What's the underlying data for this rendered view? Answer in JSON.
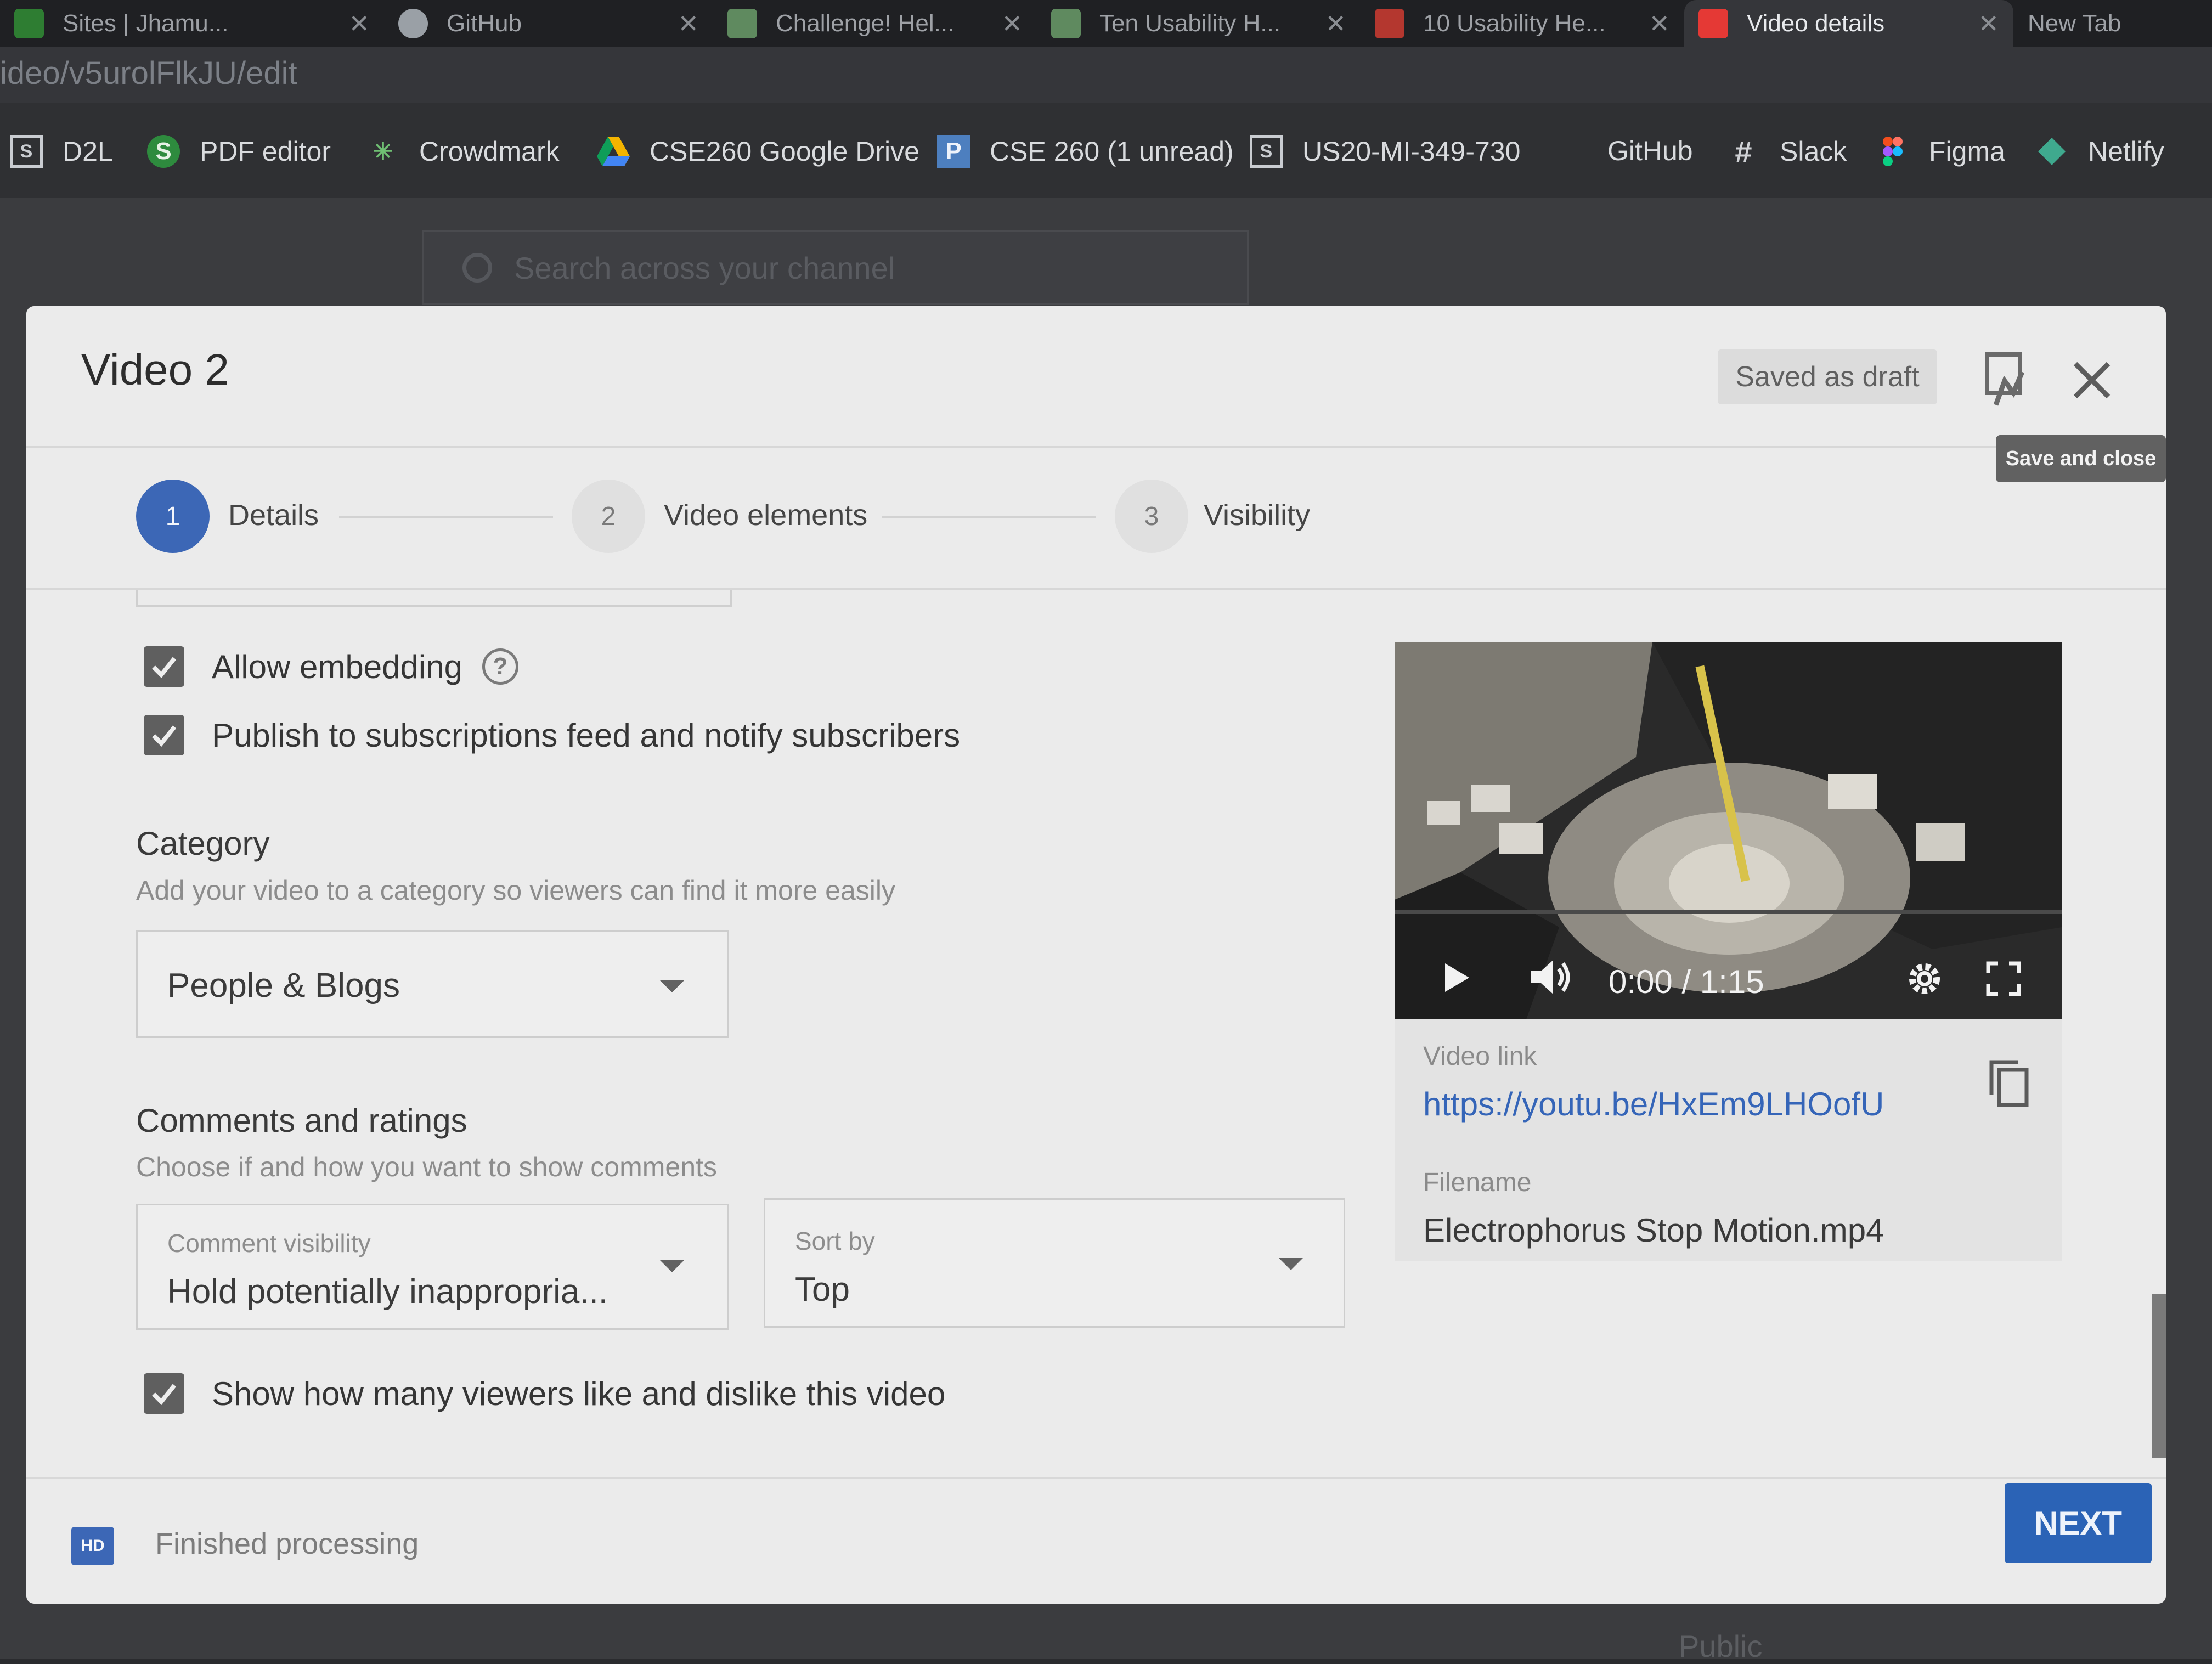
{
  "browser": {
    "tabs": [
      {
        "title": "Sites | Jhamu...",
        "fav_color": "#2e7d32"
      },
      {
        "title": "GitHub",
        "fav_color": "#9aa0a6"
      },
      {
        "title": "Challenge! Hel...",
        "fav_color": "#5f8a5f"
      },
      {
        "title": "Ten Usability H...",
        "fav_color": "#5f8a5f"
      },
      {
        "title": "10 Usability He...",
        "fav_color": "#b4372f"
      },
      {
        "title": "Video details",
        "fav_color": "#e53935"
      },
      {
        "title": "New Tab",
        "fav_color": "#9aa0a6"
      }
    ],
    "url": "ideo/v5urolFlkJU/edit",
    "bookmarks": [
      {
        "label": "D2L",
        "icon": "d2l-icon"
      },
      {
        "label": "PDF editor",
        "icon": "pdf-editor-icon"
      },
      {
        "label": "Crowdmark",
        "icon": "crowdmark-icon"
      },
      {
        "label": "CSE260 Google Drive",
        "icon": "google-drive-icon"
      },
      {
        "label": "CSE 260 (1 unread)",
        "icon": "piazza-icon"
      },
      {
        "label": "US20-MI-349-730",
        "icon": "d2l-icon"
      },
      {
        "label": "GitHub",
        "icon": "github-icon"
      },
      {
        "label": "Slack",
        "icon": "slack-icon"
      },
      {
        "label": "Figma",
        "icon": "figma-icon"
      },
      {
        "label": "Netlify",
        "icon": "netlify-icon"
      }
    ]
  },
  "background_page": {
    "search_placeholder": "Search across your channel",
    "visibility_text": "Public"
  },
  "modal": {
    "title": "Video 2",
    "draft_status": "Saved as draft",
    "close_tooltip": "Save and close",
    "steps": [
      {
        "number": "1",
        "label": "Details",
        "active": true
      },
      {
        "number": "2",
        "label": "Video elements",
        "active": false
      },
      {
        "number": "3",
        "label": "Visibility",
        "active": false
      }
    ],
    "allow_embedding": {
      "label": "Allow embedding",
      "checked": true
    },
    "publish_feed": {
      "label": "Publish to subscriptions feed and notify subscribers",
      "checked": true
    },
    "category": {
      "title": "Category",
      "subtitle": "Add your video to a category so viewers can find it more easily",
      "value": "People & Blogs"
    },
    "comments": {
      "title": "Comments and ratings",
      "subtitle": "Choose if and how you want to show comments",
      "visibility_label": "Comment visibility",
      "visibility_value": "Hold potentially inappropria...",
      "sort_label": "Sort by",
      "sort_value": "Top"
    },
    "show_ratings": {
      "label": "Show how many viewers like and dislike this video",
      "checked": true
    },
    "preview": {
      "time": "0:00 / 1:15",
      "video_link_label": "Video link",
      "video_link": "https://youtu.be/HxEm9LHOofU",
      "filename_label": "Filename",
      "filename": "Electrophorus Stop Motion.mp4"
    },
    "footer": {
      "hd_badge": "HD",
      "status": "Finished processing",
      "next_label": "NEXT"
    }
  },
  "colors": {
    "accent": "#3c67b6",
    "link": "#3565b8",
    "next_button": "#2b63b6"
  }
}
